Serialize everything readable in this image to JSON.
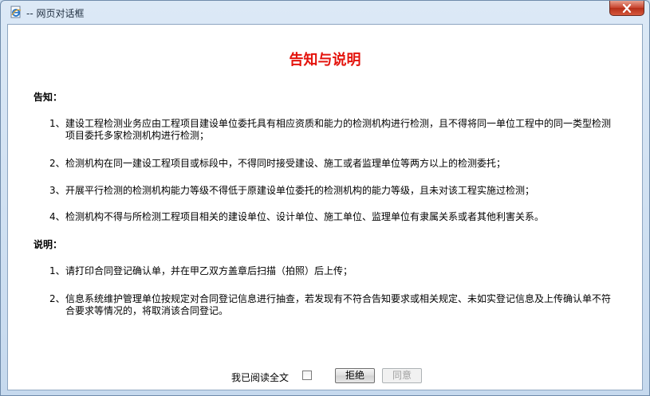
{
  "window": {
    "title": "-- 网页对话框"
  },
  "dialog": {
    "heading": "告知与说明",
    "notice": {
      "title": "告知：",
      "items": [
        {
          "num": "1、",
          "text": "建设工程检测业务应由工程项目建设单位委托具有相应资质和能力的检测机构进行检测，且不得将同一单位工程中的同一类型检测项目委托多家检测机构进行检测；"
        },
        {
          "num": "2、",
          "text": "检测机构在同一建设工程项目或标段中，不得同时接受建设、施工或者监理单位等两方以上的检测委托；"
        },
        {
          "num": "3、",
          "text": "开展平行检测的检测机构能力等级不得低于原建设单位委托的检测机构的能力等级，且未对该工程实施过检测；"
        },
        {
          "num": "4、",
          "text": "检测机构不得与所检测工程项目相关的建设单位、设计单位、施工单位、监理单位有隶属关系或者其他利害关系。"
        }
      ]
    },
    "explanation": {
      "title": "说明：",
      "items": [
        {
          "num": "1、",
          "text": "请打印合同登记确认单，并在甲乙双方盖章后扫描（拍照）后上传；"
        },
        {
          "num": "2、",
          "text": "信息系统维护管理单位按规定对合同登记信息进行抽查，若发现有不符合告知要求或相关规定、未如实登记信息及上传确认单不符合要求等情况的，将取消该合同登记。"
        }
      ]
    },
    "footer": {
      "read_label": "我已阅读全文",
      "read_checked": false,
      "reject_label": "拒绝",
      "agree_label": "同意",
      "agree_enabled": false
    }
  },
  "colors": {
    "heading": "#e4130c",
    "close_button": "#c7412b"
  },
  "icons": {
    "app": "ie-page-icon",
    "close": "close-x-icon"
  }
}
